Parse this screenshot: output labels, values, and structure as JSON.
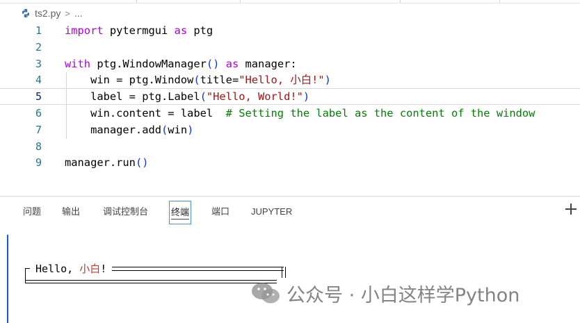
{
  "breadcrumb": {
    "file": "ts2.py",
    "separator": ">",
    "more": "..."
  },
  "editor": {
    "lines": [
      {
        "n": "1",
        "tokens": [
          [
            "kw",
            "import"
          ],
          [
            "plain",
            " pytermgui "
          ],
          [
            "kw",
            "as"
          ],
          [
            "plain",
            " ptg"
          ]
        ]
      },
      {
        "n": "2",
        "tokens": []
      },
      {
        "n": "3",
        "tokens": [
          [
            "kw",
            "with"
          ],
          [
            "plain",
            " ptg.WindowManager"
          ],
          [
            "paren",
            "()"
          ],
          [
            "plain",
            " "
          ],
          [
            "kw",
            "as"
          ],
          [
            "plain",
            " manager:"
          ]
        ]
      },
      {
        "n": "4",
        "tokens": [
          [
            "plain",
            "    win = ptg.Window"
          ],
          [
            "paren",
            "("
          ],
          [
            "plain",
            "title="
          ],
          [
            "str",
            "\"Hello, 小白!\""
          ],
          [
            "paren",
            ")"
          ]
        ]
      },
      {
        "n": "5",
        "tokens": [
          [
            "plain",
            "    label = ptg.Label"
          ],
          [
            "paren",
            "("
          ],
          [
            "str",
            "\"Hello, World!\""
          ],
          [
            "paren",
            ")"
          ]
        ]
      },
      {
        "n": "6",
        "tokens": [
          [
            "plain",
            "    win.content = label  "
          ],
          [
            "cmt",
            "# Setting the label as the content of the window"
          ]
        ]
      },
      {
        "n": "7",
        "tokens": [
          [
            "plain",
            "    manager.add"
          ],
          [
            "paren",
            "("
          ],
          [
            "plain",
            "win"
          ],
          [
            "paren",
            ")"
          ]
        ]
      },
      {
        "n": "8",
        "tokens": []
      },
      {
        "n": "9",
        "tokens": [
          [
            "plain",
            "manager.run"
          ],
          [
            "paren",
            "()"
          ]
        ]
      }
    ],
    "current_line": 5
  },
  "panel": {
    "tabs": [
      "问题",
      "输出",
      "调试控制台",
      "终端",
      "端口",
      "JUPYTER"
    ],
    "active_tab": "终端"
  },
  "terminal": {
    "window_title_prefix": "Hello, ",
    "window_title_cjk": "小白",
    "window_title_suffix": "!"
  },
  "watermark": {
    "text": "公众号 · 小白这样学Python"
  },
  "icons": {
    "file_icon": "python-file-icon",
    "add_icon": "plus-icon",
    "watermark_icon": "wechat-icon"
  },
  "colors": {
    "keyword": "#af00db",
    "string": "#a31515",
    "comment": "#008000",
    "line_number": "#237893",
    "active_tab_border": "#4a8fdc",
    "terminal_bar": "#0b62c4"
  }
}
